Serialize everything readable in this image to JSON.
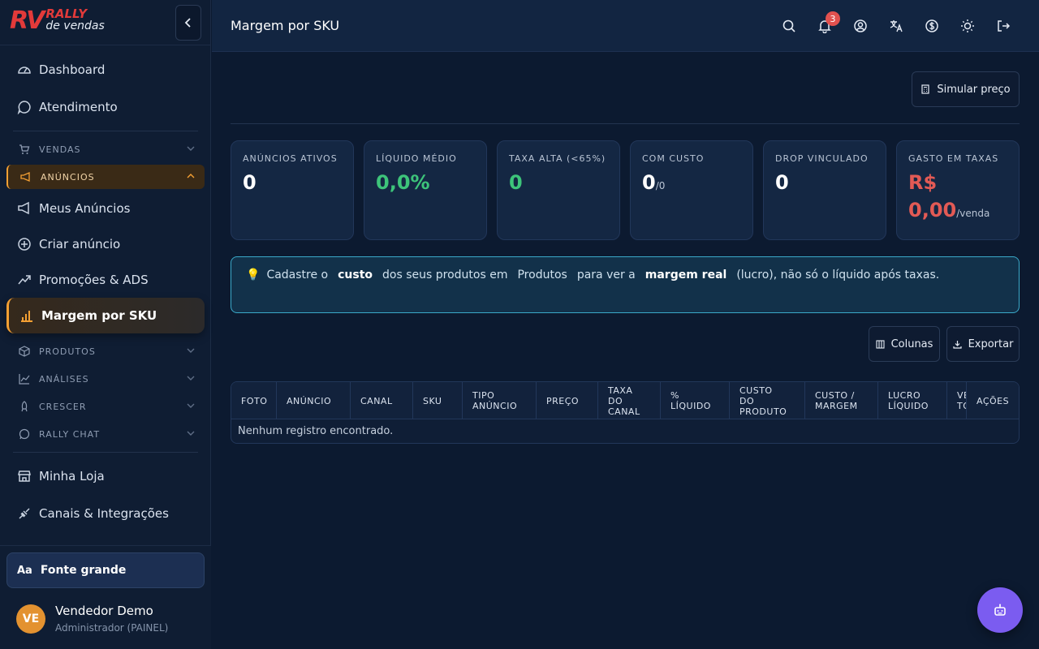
{
  "brand": {
    "logo_mark": "RV",
    "logo_top": "RALLY",
    "logo_bottom": "de vendas"
  },
  "sidebar": {
    "dashboard": "Dashboard",
    "atendimento": "Atendimento",
    "vendas": "VENDAS",
    "anuncios": "ANÚNCIOS",
    "meus_anuncios": "Meus Anúncios",
    "criar_anuncio": "Criar anúncio",
    "promocoes": "Promoções & ADS",
    "margem": "Margem por SKU",
    "produtos": "PRODUTOS",
    "analises": "ANÁLISES",
    "crescer": "CRESCER",
    "rally_chat": "RALLY CHAT",
    "minha_loja": "Minha Loja",
    "canais": "Canais & Integrações"
  },
  "footer": {
    "font_button": "Fonte grande",
    "font_icon": "Aa",
    "user_initials": "VE",
    "user_name": "Vendedor Demo",
    "user_role": "Administrador (PAINEL)"
  },
  "header": {
    "title": "Margem por SKU",
    "notification_count": "3",
    "icons": [
      "search-icon",
      "bell-icon",
      "account-icon",
      "translate-icon",
      "currency-icon",
      "sun-icon",
      "logout-icon"
    ]
  },
  "actions": {
    "simular": "Simular preço",
    "colunas": "Colunas",
    "exportar": "Exportar"
  },
  "cards": [
    {
      "label": "ANÚNCIOS ATIVOS",
      "value": "0"
    },
    {
      "label": "LÍQUIDO MÉDIO",
      "value": "0,0%"
    },
    {
      "label": "TAXA ALTA (<65%)",
      "value": "0"
    },
    {
      "label": "COM CUSTO",
      "value": "0",
      "suffix": "/0"
    },
    {
      "label": "DROP VINCULADO",
      "value": "0"
    },
    {
      "label": "GASTO EM TAXAS",
      "value_line1": "R$",
      "value_line2": "0,00",
      "suffix": "/venda"
    }
  ],
  "info": {
    "p1": "Cadastre o",
    "b1": "custo",
    "p2": "dos seus produtos em",
    "link": "Produtos",
    "p3": "para ver a",
    "b2": "margem real",
    "p4": "(lucro), não só o líquido após taxas."
  },
  "table": {
    "columns": [
      "FOTO",
      "ANÚNCIO",
      "CANAL",
      "SKU",
      "TIPO ANÚNCIO",
      "PREÇO",
      "TAXA DO CANAL",
      "% LÍQUIDO",
      "CUSTO DO PRODUTO",
      "CUSTO / MARGEM",
      "LUCRO LÍQUIDO",
      "VE TO",
      "AÇÕES"
    ],
    "empty_message": "Nenhum registro encontrado."
  },
  "colors": {
    "accent": "#f5a033",
    "brand_red": "#e23a3a",
    "positive": "#3dc47a",
    "negative": "#e25a55",
    "info_border": "#3aa9c9",
    "fab": "#7b5cf0"
  }
}
